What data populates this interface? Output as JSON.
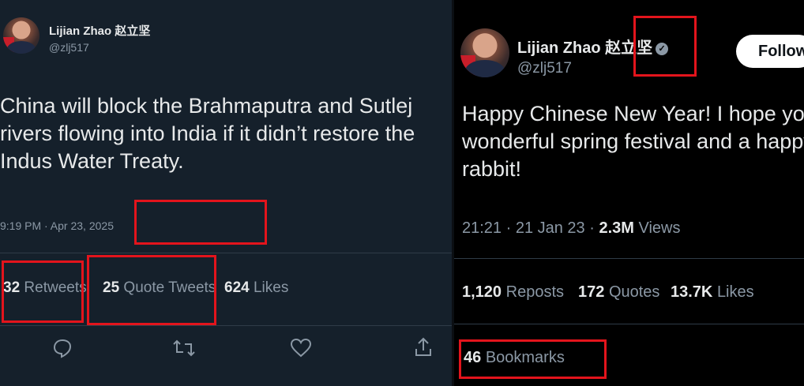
{
  "left_tweet": {
    "author_name": "Lijian Zhao 赵立坚",
    "handle": "@zlj517",
    "text": "China will block the Brahmaputra and Sutlej rivers flowing into India if it didn’t restore the Indus Water Treaty.",
    "timestamp": "9:19 PM · Apr 23, 2025",
    "stats": {
      "retweets_count": "32",
      "retweets_label": "Retweets",
      "quotes_count": "25",
      "quotes_label": "Quote Tweets",
      "likes_count": "624",
      "likes_label": "Likes"
    },
    "actions": {
      "reply": "reply-icon",
      "retweet": "retweet-icon",
      "like": "heart-icon",
      "share": "share-icon"
    }
  },
  "right_tweet": {
    "author_name": "Lijian Zhao 赵立坚",
    "handle": "@zlj517",
    "follow_label": "Follow",
    "text": "Happy Chinese New Year! I hope you have a wonderful spring festival and a happy year of the rabbit!",
    "timestamp": "21:21 · 21 Jan 23 · ",
    "views_count": "2.3M",
    "views_label": "Views",
    "stats": {
      "reposts_count": "1,120",
      "reposts_label": "Reposts",
      "quotes_count": "172",
      "quotes_label": "Quotes",
      "likes_count": "13.7K",
      "likes_label": "Likes",
      "bookmarks_count": "46",
      "bookmarks_label": "Bookmarks"
    }
  },
  "colors": {
    "highlight": "#e3141c",
    "left_bg": "#15202b",
    "right_bg": "#000000"
  }
}
